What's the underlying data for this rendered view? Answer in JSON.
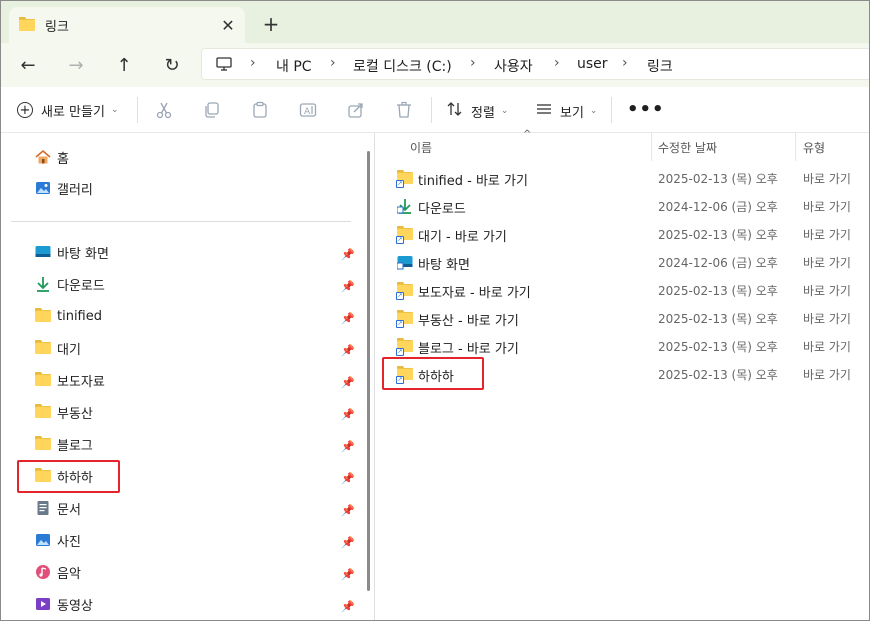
{
  "window": {
    "tab_title": "링크",
    "tab_close": "✕",
    "new_tab": "+"
  },
  "nav": {
    "back": "←",
    "forward": "→",
    "up": "↑",
    "refresh": "↻"
  },
  "breadcrumb": {
    "items": [
      "내 PC",
      "로컬 디스크 (C:)",
      "사용자",
      "user",
      "링크"
    ],
    "separator": "›"
  },
  "commandbar": {
    "new_label": "새로 만들기",
    "sort_label": "정렬",
    "view_label": "보기",
    "more_label": "•••"
  },
  "sidebar": {
    "home": "홈",
    "gallery": "갤러리",
    "items": [
      {
        "label": "바탕 화면",
        "icon": "desktop-icon"
      },
      {
        "label": "다운로드",
        "icon": "download-icon"
      },
      {
        "label": "tinified",
        "icon": "folder-icon"
      },
      {
        "label": "대기",
        "icon": "folder-icon"
      },
      {
        "label": "보도자료",
        "icon": "folder-icon"
      },
      {
        "label": "부동산",
        "icon": "folder-icon"
      },
      {
        "label": "블로그",
        "icon": "folder-icon"
      },
      {
        "label": "하하하",
        "icon": "folder-icon"
      },
      {
        "label": "문서",
        "icon": "document-icon"
      },
      {
        "label": "사진",
        "icon": "pictures-icon"
      },
      {
        "label": "음악",
        "icon": "music-icon"
      },
      {
        "label": "동영상",
        "icon": "videos-icon"
      }
    ]
  },
  "list": {
    "columns": {
      "name": "이름",
      "date": "수정한 날짜",
      "type": "유형"
    },
    "rows": [
      {
        "name": "tinified - 바로 가기",
        "date": "2025-02-13 (목) 오후",
        "type": "바로 가기",
        "icon": "folder-shortcut-icon"
      },
      {
        "name": "다운로드",
        "date": "2024-12-06 (금) 오후",
        "type": "바로 가기",
        "icon": "download-shortcut-icon"
      },
      {
        "name": "대기 - 바로 가기",
        "date": "2025-02-13 (목) 오후",
        "type": "바로 가기",
        "icon": "folder-shortcut-icon"
      },
      {
        "name": "바탕 화면",
        "date": "2024-12-06 (금) 오후",
        "type": "바로 가기",
        "icon": "desktop-shortcut-icon"
      },
      {
        "name": "보도자료 - 바로 가기",
        "date": "2025-02-13 (목) 오후",
        "type": "바로 가기",
        "icon": "folder-shortcut-icon"
      },
      {
        "name": "부동산 - 바로 가기",
        "date": "2025-02-13 (목) 오후",
        "type": "바로 가기",
        "icon": "folder-shortcut-icon"
      },
      {
        "name": "블로그 - 바로 가기",
        "date": "2025-02-13 (목) 오후",
        "type": "바로 가기",
        "icon": "folder-shortcut-icon"
      },
      {
        "name": "하하하",
        "date": "2025-02-13 (목) 오후",
        "type": "바로 가기",
        "icon": "folder-shortcut-icon"
      }
    ]
  },
  "colors": {
    "titlebar": "#e8f0e0",
    "highlight": "#e5232a",
    "folder": "#ffd65b"
  }
}
